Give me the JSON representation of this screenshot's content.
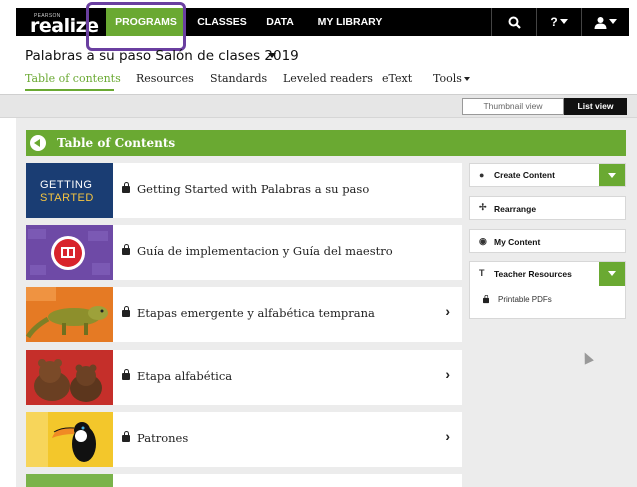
{
  "app": {
    "logo_small": "PEARSON",
    "logo_main": "realize"
  },
  "topnav": {
    "items": [
      {
        "label": "PROGRAMS",
        "active": true
      },
      {
        "label": "CLASSES"
      },
      {
        "label": "DATA"
      },
      {
        "label": "MY LIBRARY"
      }
    ],
    "search_icon": "search-icon",
    "help_label": "?",
    "user_icon": "user-icon"
  },
  "program": {
    "title": "Palabras a su paso Salón de clases 2019"
  },
  "subnav": {
    "items": [
      {
        "label": "Table of contents",
        "active": true
      },
      {
        "label": "Resources"
      },
      {
        "label": "Standards"
      },
      {
        "label": "Leveled readers"
      },
      {
        "label": "eText"
      },
      {
        "label": "Tools"
      }
    ]
  },
  "view_toggle": {
    "thumbnail": "Thumbnail view",
    "list": "List view",
    "selected": "List view"
  },
  "toc": {
    "title": "Table of Contents",
    "items": [
      {
        "label": "Getting Started with Palabras a su paso",
        "thumb_line1": "GETTING",
        "thumb_line2": "STARTED",
        "has_chevron": false
      },
      {
        "label": "Guía de implementacion y Guía del maestro",
        "has_chevron": false
      },
      {
        "label": "Etapas emergente y alfabética temprana",
        "has_chevron": true
      },
      {
        "label": "Etapa alfabética",
        "has_chevron": true
      },
      {
        "label": "Patrones",
        "has_chevron": true
      }
    ]
  },
  "right_panel": {
    "create_content": "Create Content",
    "rearrange": "Rearrange",
    "my_content": "My Content",
    "teacher_resources": "Teacher Resources",
    "printable_pdfs": "Printable PDFs"
  },
  "colors": {
    "brand_green": "#6aa932",
    "nav_black": "#000000",
    "highlight_purple": "#6a3fa0"
  }
}
